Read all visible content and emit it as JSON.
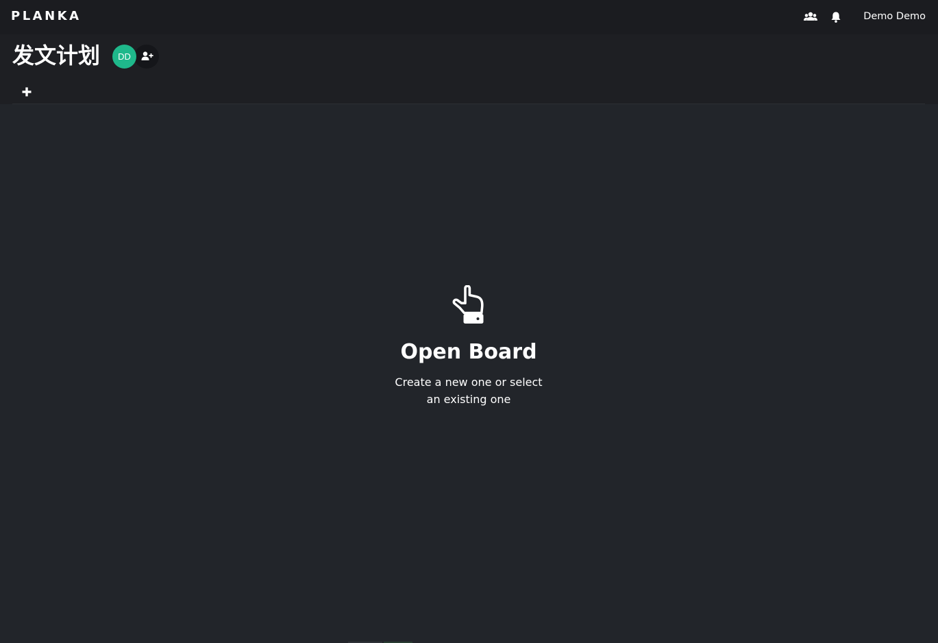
{
  "app": {
    "logo": "PLANKA"
  },
  "topbar": {
    "users_icon": "users-icon",
    "notifications_icon": "bell-icon",
    "user_name": "Demo Demo"
  },
  "project": {
    "title": "发文计划",
    "member_initials": "DD",
    "avatar_color": "#1fb88b",
    "add_member_icon": "user-plus-icon"
  },
  "boards": {
    "add_icon": "plus-icon"
  },
  "placeholder": {
    "icon": "pointing-hand-icon",
    "title": "Open Board",
    "text": "Create a new one or select an existing one"
  },
  "colors": {
    "background": "#22252a",
    "topbar": "#1b1c20",
    "header": "#1e1f23",
    "accent": "#1fb88b"
  }
}
